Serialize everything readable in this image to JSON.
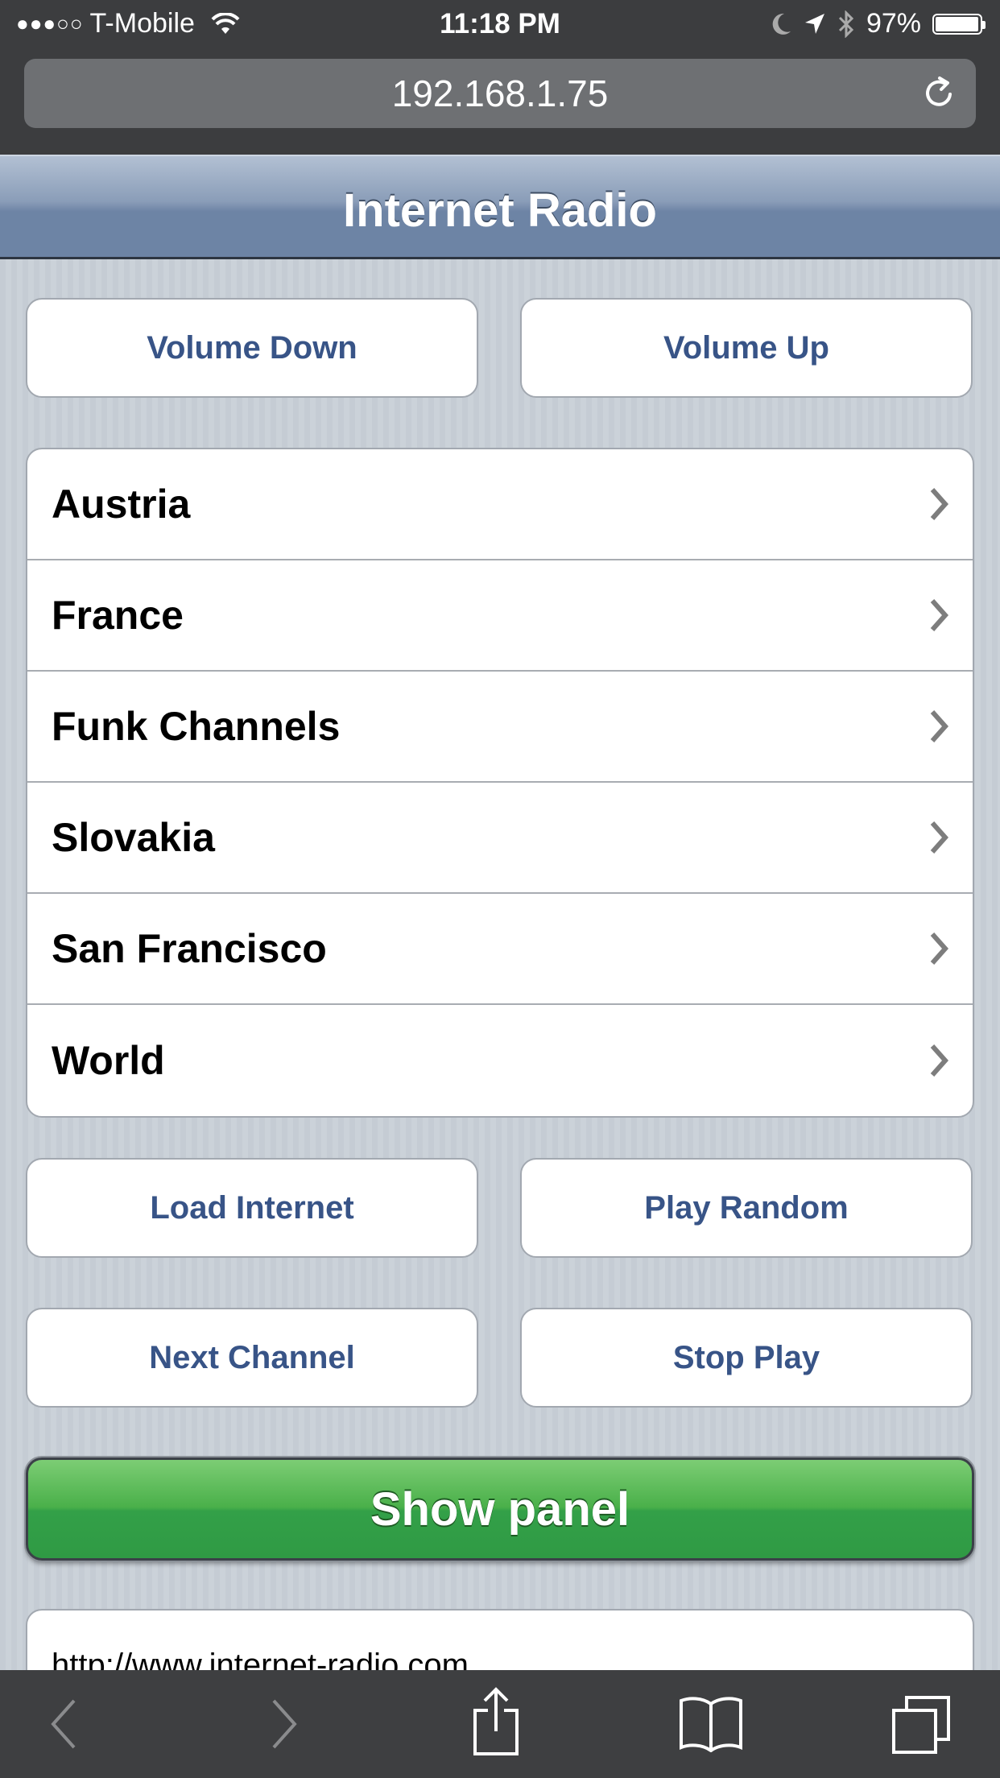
{
  "status_bar": {
    "signal": "●●●○○",
    "carrier": "T-Mobile",
    "time": "11:18 PM",
    "battery": "97%"
  },
  "browser": {
    "url": "192.168.1.75"
  },
  "header": {
    "title": "Internet Radio"
  },
  "buttons": {
    "volume_down": "Volume Down",
    "volume_up": "Volume Up",
    "load_internet": "Load Internet",
    "play_random": "Play Random",
    "next_channel": "Next Channel",
    "stop_play": "Stop Play",
    "show_panel": "Show panel"
  },
  "channels": [
    {
      "label": "Austria"
    },
    {
      "label": "France"
    },
    {
      "label": "Funk Channels"
    },
    {
      "label": "Slovakia"
    },
    {
      "label": "San Francisco"
    },
    {
      "label": "World"
    }
  ],
  "footer_link": "http://www.internet-radio.com",
  "colors": {
    "button_text": "#385487",
    "show_panel_green": "#3aa64a",
    "header_blue": "#6d84a5"
  }
}
